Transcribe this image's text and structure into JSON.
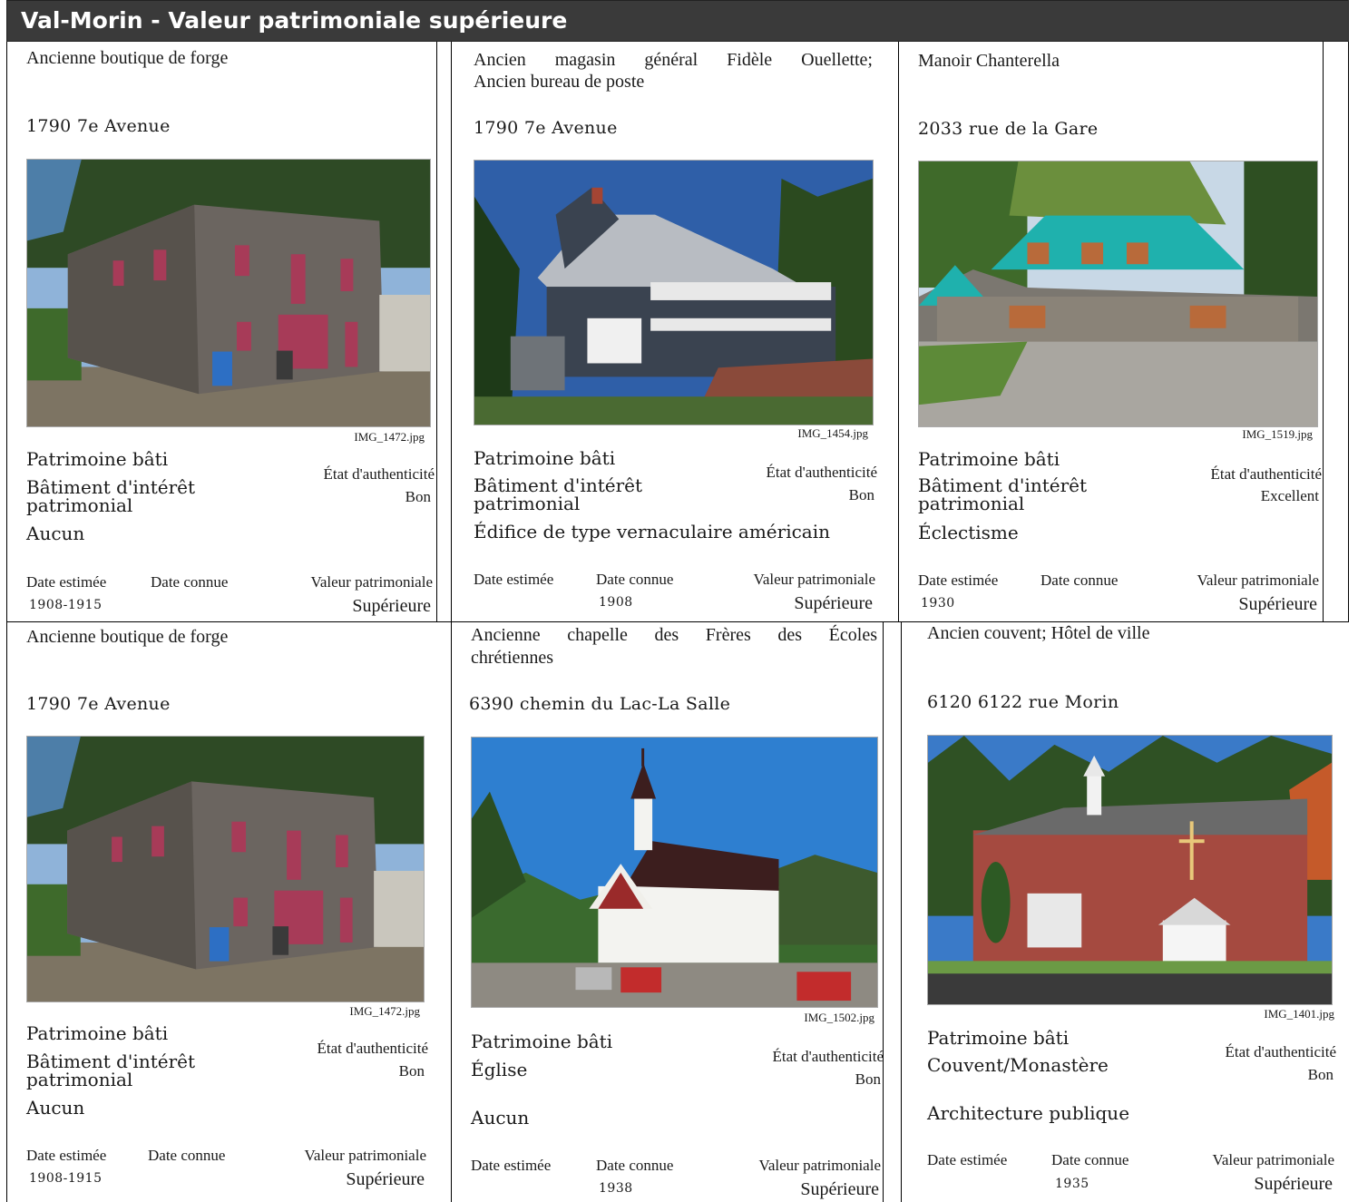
{
  "header": {
    "title": "Val-Morin - Valeur patrimoniale supérieure"
  },
  "labels": {
    "etat": "État d'authenticité",
    "date_estimee": "Date estimée",
    "date_connue": "Date connue",
    "valeur": "Valeur patrimoniale"
  },
  "cards": [
    {
      "name": "Ancienne boutique de forge",
      "address": "1790 7e Avenue",
      "filename": "IMG_1472.jpg",
      "type": "Patrimoine bâti",
      "category": "Bâtiment d'intérêt patrimonial",
      "style": "Aucun",
      "etat": "Bon",
      "date_estimee": "1908-1915",
      "date_connue": "",
      "valeur": "Supérieure",
      "photo_icon": "forge-building-photo"
    },
    {
      "name": "Ancien magasin général Fidèle Ouellette;",
      "name_line2": "Ancien bureau de poste",
      "address": "1790 7e Avenue",
      "filename": "IMG_1454.jpg",
      "type": "Patrimoine bâti",
      "category": "Bâtiment d'intérêt patrimonial",
      "style": "Édifice de type vernaculaire américain",
      "etat": "Bon",
      "date_estimee": "",
      "date_connue": "1908",
      "valeur": "Supérieure",
      "photo_icon": "general-store-photo"
    },
    {
      "name": "Manoir Chanterella",
      "address": "2033 rue de la Gare",
      "filename": "IMG_1519.jpg",
      "type": "Patrimoine bâti",
      "category": "Bâtiment d'intérêt patrimonial",
      "style": "Éclectisme",
      "etat": "Excellent",
      "date_estimee": "1930",
      "date_connue": "",
      "valeur": "Supérieure",
      "photo_icon": "manor-photo"
    },
    {
      "name": "Ancienne boutique de forge",
      "address": "1790 7e Avenue",
      "filename": "IMG_1472.jpg",
      "type": "Patrimoine bâti",
      "category": "Bâtiment d'intérêt patrimonial",
      "style": "Aucun",
      "etat": "Bon",
      "date_estimee": "1908-1915",
      "date_connue": "",
      "valeur": "Supérieure",
      "photo_icon": "forge-building-photo"
    },
    {
      "name": "Ancienne chapelle des Frères des Écoles",
      "name_line2": "chrétiennes",
      "address": "6390 chemin du Lac-La Salle",
      "filename": "IMG_1502.jpg",
      "type": "Patrimoine bâti",
      "category": "Église",
      "style": "Aucun",
      "etat": "Bon",
      "date_estimee": "",
      "date_connue": "1938",
      "valeur": "Supérieure",
      "photo_icon": "chapel-photo"
    },
    {
      "name": "Ancien couvent; Hôtel de ville",
      "address": "6120 6122 rue Morin",
      "filename": "IMG_1401.jpg",
      "type": "Patrimoine bâti",
      "category": "Couvent/Monastère",
      "style": "Architecture publique",
      "etat": "Bon",
      "date_estimee": "",
      "date_connue": "1935",
      "valeur": "Supérieure",
      "photo_icon": "convent-photo"
    }
  ]
}
